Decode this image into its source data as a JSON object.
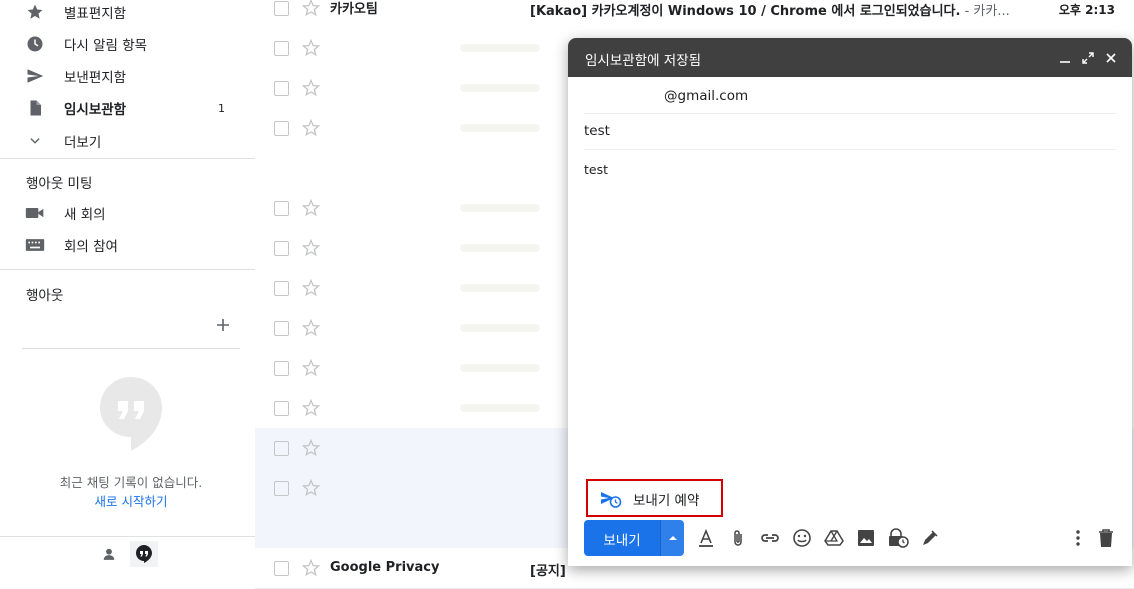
{
  "sidebar": {
    "items": [
      {
        "label": "별표편지함",
        "icon": "star-icon"
      },
      {
        "label": "다시 알림 항목",
        "icon": "clock-icon"
      },
      {
        "label": "보낸편지함",
        "icon": "send-icon"
      },
      {
        "label": "임시보관함",
        "icon": "draft-icon",
        "count": "1"
      },
      {
        "label": "더보기",
        "icon": "chevron-down-icon"
      }
    ],
    "meet_title": "행아웃 미팅",
    "meet_items": [
      {
        "label": "새 회의",
        "icon": "video-icon"
      },
      {
        "label": "회의 참여",
        "icon": "keyboard-icon"
      }
    ],
    "hangouts_title": "행아웃",
    "empty_text": "최근 채팅 기록이 없습니다.",
    "empty_link": "새로 시작하기"
  },
  "emails": [
    {
      "sender": "카카오팀",
      "subject": "[Kakao] 카카오계정이 Windows 10 / Chrome 에서 로그인되었습니다.",
      "snippet": " - 카카...",
      "time": "오후 2:13"
    },
    {
      "sender": "Google Privacy",
      "subject": "[공지]"
    }
  ],
  "compose": {
    "title": "임시보관함에 저장됨",
    "to": "@gmail.com",
    "subject": "test",
    "body": "test",
    "schedule_label": "보내기 예약",
    "send_label": "보내기"
  },
  "colors": {
    "accent": "#1a73e8",
    "header": "#404040",
    "highlight": "#d40000"
  }
}
